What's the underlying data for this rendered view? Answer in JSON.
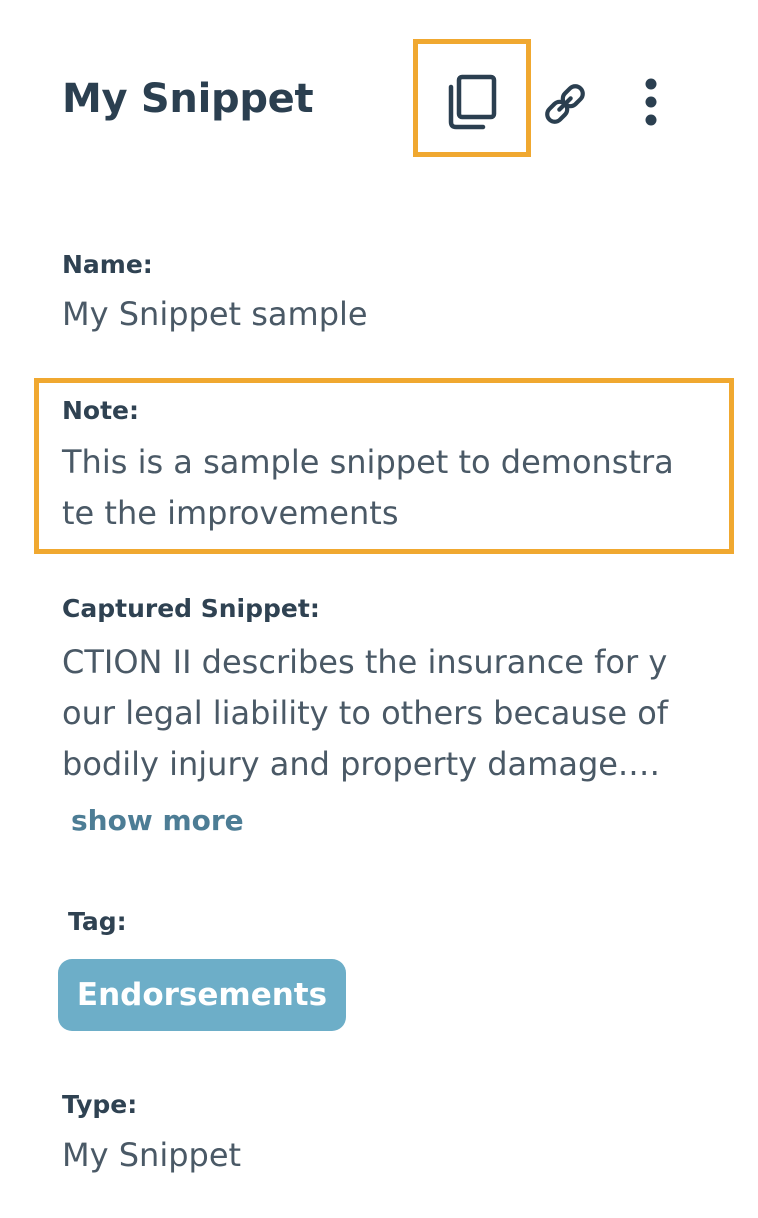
{
  "header": {
    "title": "My Snippet",
    "icons": [
      "copy-icon",
      "link-icon",
      "more-vertical-icon"
    ]
  },
  "fields": {
    "name": {
      "label": "Name:",
      "value": "My Snippet sample"
    },
    "note": {
      "label": "Note:",
      "value": "This is a sample snippet to demonstra\nte the improvements"
    },
    "captured": {
      "label": "Captured Snippet:",
      "value": "CTION II describes the insurance for y\nour legal liability to others because of\nbodily injury and property damage.…",
      "show_more": "show more"
    },
    "tag": {
      "label": "Tag:",
      "value": "Endorsements"
    },
    "type": {
      "label": "Type:",
      "value": "My Snippet"
    }
  },
  "colors": {
    "highlight": "#f0a830",
    "tag_background": "#6daec8",
    "heading_text": "#2b3f50",
    "body_text": "#4a5966",
    "link_text": "#4d7d95"
  }
}
